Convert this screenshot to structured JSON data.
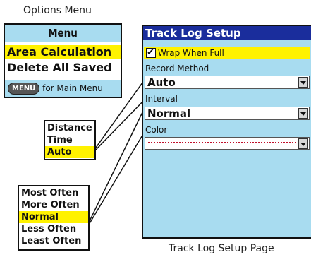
{
  "options_caption": "Options Menu",
  "track_caption": "Track Log Setup Page",
  "options_menu": {
    "header": "Menu",
    "items": [
      "Area Calculation",
      "Delete All Saved"
    ],
    "selected_index": 0,
    "footer_key": "MENU",
    "footer_text": "for Main Menu"
  },
  "record_popup": {
    "options": [
      "Distance",
      "Time",
      "Auto"
    ],
    "selected_index": 2
  },
  "interval_popup": {
    "options": [
      "Most Often",
      "More Often",
      "Normal",
      "Less Often",
      "Least Often"
    ],
    "selected_index": 2
  },
  "track_log": {
    "title": "Track Log Setup",
    "wrap_label": "Wrap When Full",
    "wrap_checked": true,
    "record_label": "Record Method",
    "record_value": "Auto",
    "interval_label": "Interval",
    "interval_value": "Normal",
    "color_label": "Color",
    "color_value": "#c0102a"
  },
  "colors": {
    "header_blue": "#1a2d9c",
    "panel_light_blue": "#a8dcf0",
    "highlight_yellow": "#fff200"
  }
}
